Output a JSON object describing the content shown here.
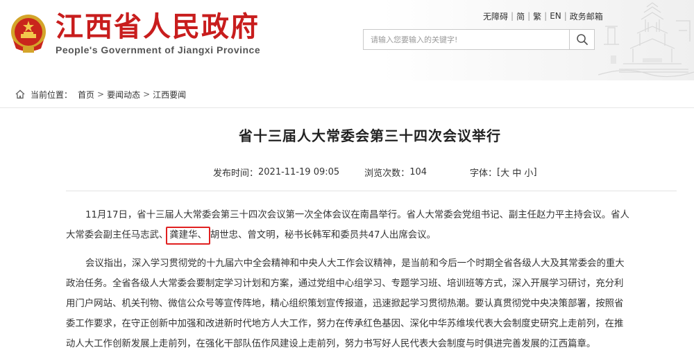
{
  "header": {
    "site_name": "江西省人民政府",
    "site_name_en": "People's Government of Jiangxi Province",
    "top_links": [
      "无障碍",
      "简",
      "繁",
      "EN",
      "政务邮箱"
    ],
    "search_placeholder": "请输入您要输入的关键字!",
    "search_icon": "search-icon",
    "brand_color": "#c81d1d"
  },
  "breadcrumb": {
    "label": "当前位置：",
    "items": [
      "首页",
      "要闻动态",
      "江西要闻"
    ],
    "separator": ">"
  },
  "article": {
    "title": "省十三届人大常委会第三十四次会议举行",
    "publish_label": "发布时间：",
    "publish_time": "2021-11-19 09:05",
    "views_label": "浏览次数：",
    "views": "104",
    "fontsize_label": "字体：",
    "fontsize_open": "[",
    "fontsize_options": [
      "大",
      "中",
      "小"
    ],
    "fontsize_close": "]",
    "paragraph1": {
      "line1": "11月17日，省十三届人大常委会第三十四次会议第一次全体会议在南昌举行。省人大常委会党组书记、副主任赵力平主持会议。省人",
      "line2_before": "大常委会副主任马志武、",
      "line2_highlight": "龚建华、",
      "line2_after": "胡世忠、曾文明，秘书长韩军和委员共47人出席会议。"
    },
    "paragraph2": [
      "会议指出，深入学习贯彻党的十九届六中全会精神和中央人大工作会议精神，是当前和今后一个时期全省各级人大及其常委会的重大",
      "政治任务。全省各级人大常委会要制定学习计划和方案，通过党组中心组学习、专题学习班、培训班等方式，深入开展学习研讨，充分利",
      "用门户网站、机关刊物、微信公众号等宣传阵地，精心组织策划宣传报道，迅速掀起学习贯彻热潮。要认真贯彻党中央决策部署，按照省",
      "委工作要求，在守正创新中加强和改进新时代地方人大工作，努力在传承红色基因、深化中华苏维埃代表大会制度史研究上走前列，在推",
      "动人大工作创新发展上走前列，在强化干部队伍作风建设上走前列，努力书写好人民代表大会制度与时俱进完善发展的江西篇章。"
    ],
    "highlight_color": "#e02020"
  }
}
